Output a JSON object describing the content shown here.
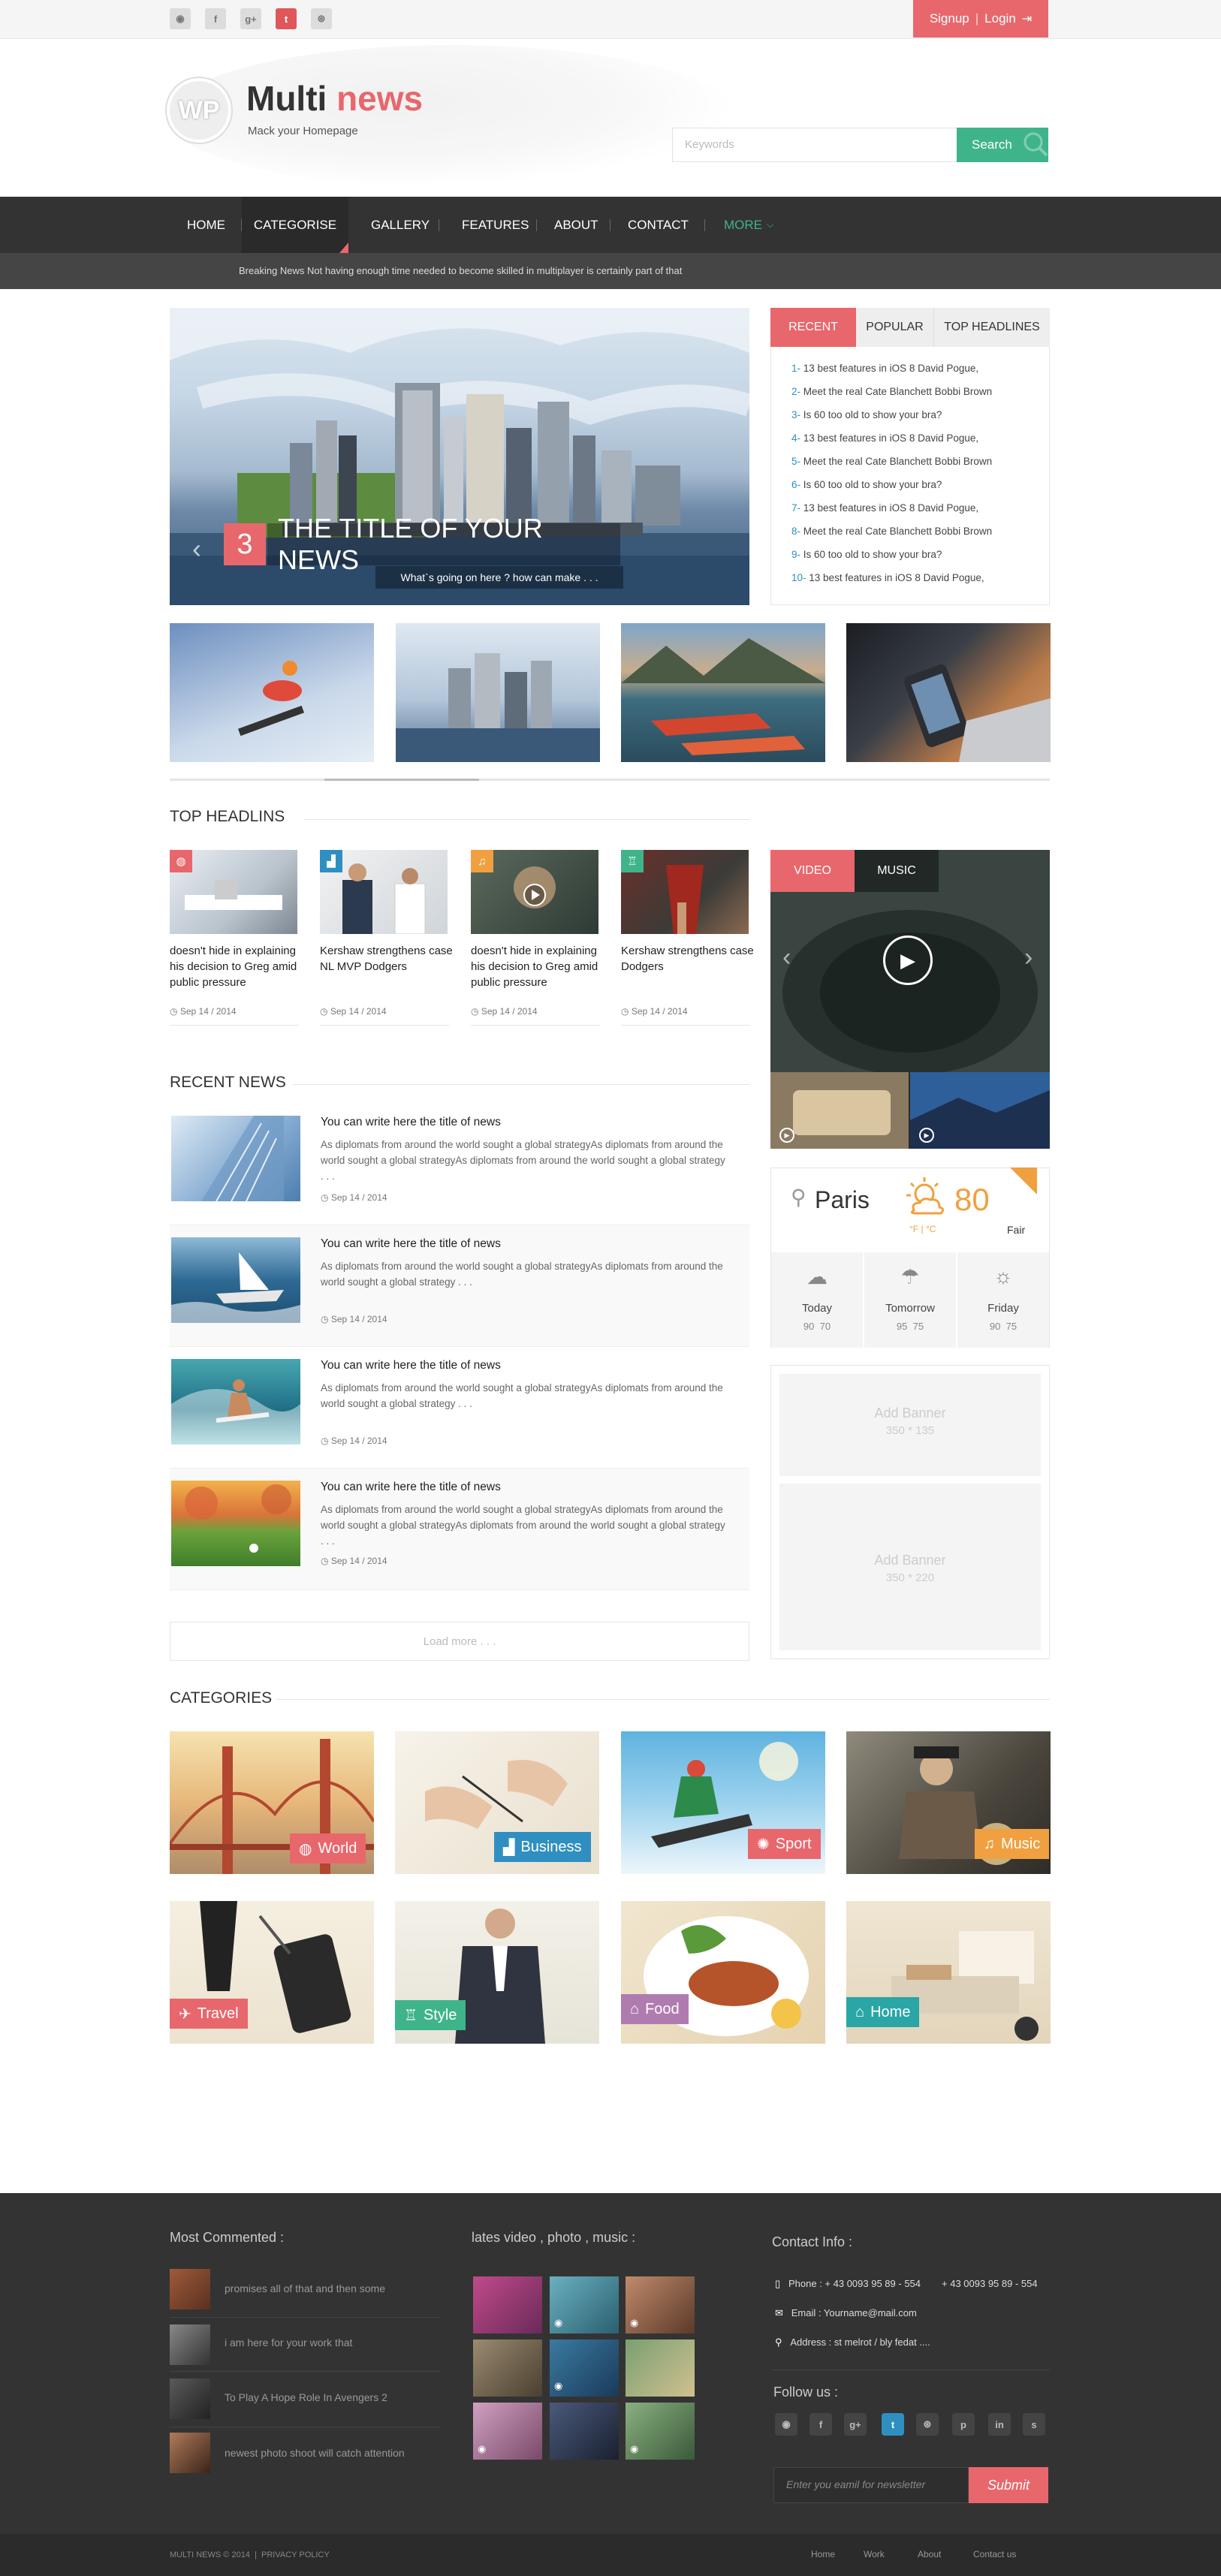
{
  "topbar": {
    "social_icons": [
      "rss-icon",
      "facebook-icon",
      "google-plus-icon",
      "twitter-icon",
      "dribbble-icon"
    ],
    "signup": "Signup",
    "login": "Login"
  },
  "brand": {
    "logo_mark": "WP",
    "title_a": "Multi",
    "title_b": "news",
    "tagline": "Mack your Homepage",
    "accent": "#e8676c",
    "green": "#3fb48b"
  },
  "search": {
    "placeholder": "Keywords",
    "button": "Search"
  },
  "nav": {
    "items": [
      "HOME",
      "CATEGORISE",
      "GALLERY",
      "FEATURES",
      "ABOUT",
      "CONTACT",
      "MORE"
    ]
  },
  "breaking": "Breaking News Not having enough time needed to become skilled in multiplayer is certainly part of that",
  "slider": {
    "number": "3",
    "title": "THE TITLE OF YOUR NEWS",
    "subtitle": "What`s going on here ? how can make . . ."
  },
  "headline_tabs": {
    "tabs": [
      "RECENT",
      "POPULAR",
      "TOP HEADLINES"
    ],
    "items": [
      {
        "n": "1-",
        "t": "13 best features in iOS 8 David Pogue,"
      },
      {
        "n": "2-",
        "t": "Meet the real Cate Blanchett Bobbi Brown"
      },
      {
        "n": "3-",
        "t": "Is 60 too old to show your bra?"
      },
      {
        "n": "4-",
        "t": "13 best features in iOS 8 David Pogue,"
      },
      {
        "n": "5-",
        "t": "Meet the real Cate Blanchett Bobbi Brown"
      },
      {
        "n": "6-",
        "t": "Is 60 too old to show your bra?"
      },
      {
        "n": "7-",
        "t": "13 best features in iOS 8 David Pogue,"
      },
      {
        "n": "8-",
        "t": "Meet the real Cate Blanchett Bobbi Brown"
      },
      {
        "n": "9-",
        "t": "Is 60 too old to show your bra?"
      },
      {
        "n": "10-",
        "t": "13 best features in iOS 8 David Pogue,"
      }
    ]
  },
  "top_headlines": {
    "title": "TOP HEADLINS",
    "cards": [
      {
        "text": "doesn't hide in explaining his decision to Greg amid public pressure",
        "date": "Sep 14 / 2014",
        "icon": "globe-icon",
        "color": "#e8676c"
      },
      {
        "text": "Kershaw strengthens case NL MVP Dodgers",
        "date": "Sep 14 / 2014",
        "icon": "chart-icon",
        "color": "#2f8fc1"
      },
      {
        "text": "doesn't hide in explaining his decision to Greg amid public pressure",
        "date": "Sep 14 / 2014",
        "icon": "music-icon",
        "color": "#f0a040"
      },
      {
        "text": "Kershaw strengthens case Dodgers",
        "date": "Sep 14 / 2014",
        "icon": "shirt-icon",
        "color": "#3fb48b"
      }
    ]
  },
  "recent_news": {
    "title": "RECENT NEWS",
    "items": [
      {
        "title": "You can write here the title of news",
        "desc": "As diplomats from around the world sought a global strategyAs diplomats from around the world sought a global strategyAs diplomats from around the world sought a global strategy . . .",
        "date": "Sep 14 / 2014"
      },
      {
        "title": "You can write here the title of news",
        "desc": "As diplomats from around the world sought a global strategyAs diplomats from around the world sought a global strategy . . .",
        "date": "Sep 14 / 2014"
      },
      {
        "title": "You can write here the title of news",
        "desc": "As diplomats from around the world sought a global strategyAs diplomats from around the world sought a global strategy . . .",
        "date": "Sep 14 / 2014"
      },
      {
        "title": "You can write here the title of news",
        "desc": "As diplomats from around the world sought a global strategyAs diplomats from around the world sought a global strategyAs diplomats from around the world sought a global strategy . . .",
        "date": "Sep 14 / 2014"
      }
    ],
    "load_more": "Load more . . ."
  },
  "media": {
    "tabs": [
      "VIDEO",
      "MUSIC"
    ]
  },
  "weather": {
    "city": "Paris",
    "temp": "80",
    "units": "°F  |  °C",
    "condition": "Fair",
    "forecast": [
      {
        "day": "Today",
        "range": "90  70"
      },
      {
        "day": "Tomorrow",
        "range": "95  75"
      },
      {
        "day": "Friday",
        "range": "90  75"
      }
    ]
  },
  "banners": [
    {
      "label": "Add Banner",
      "size": "350 * 135"
    },
    {
      "label": "Add Banner",
      "size": "350 * 220"
    }
  ],
  "categories": {
    "title": "CATEGORIES",
    "items": [
      {
        "label": "World",
        "color": "#e8676c",
        "icon": "globe-icon"
      },
      {
        "label": "Business",
        "color": "#2f8fc1",
        "icon": "chart-icon"
      },
      {
        "label": "Sport",
        "color": "#e8676c",
        "icon": "ball-icon"
      },
      {
        "label": "Music",
        "color": "#f0a040",
        "icon": "music-icon"
      },
      {
        "label": "Travel",
        "color": "#e8676c",
        "icon": "plane-icon"
      },
      {
        "label": "Style",
        "color": "#3fb48b",
        "icon": "shirt-icon"
      },
      {
        "label": "Food",
        "color": "#b07cb0",
        "icon": "cake-icon"
      },
      {
        "label": "Home",
        "color": "#2aa6a6",
        "icon": "house-icon"
      }
    ]
  },
  "footer": {
    "most_commented_title": "Most Commented :",
    "most_commented": [
      "promises all of that and then some",
      "i am here for your work that",
      "To Play A Hope Role In Avengers 2",
      "newest photo shoot will catch attention"
    ],
    "media_title": "lates video , photo , music :",
    "contact_title": "Contact Info :",
    "phone": "Phone : + 43 0093 95 89 - 554",
    "phone2": "+ 43 0093 95 89 - 554",
    "email": "Email : Yourname@mail.com",
    "address": "Address : st melrot / bly fedat ....",
    "follow_title": "Follow us :",
    "follow_icons": [
      "rss-icon",
      "facebook-icon",
      "google-plus-icon",
      "twitter-icon",
      "dribbble-icon",
      "pinterest-icon",
      "linkedin-icon",
      "skype-icon"
    ],
    "newsletter_placeholder": "Enter you eamil  for newsletter",
    "submit": "Submit",
    "copyright": "MULTI NEWS  © 2014",
    "privacy": "PRIVACY POLICY",
    "links": [
      "Home",
      "Work",
      "About",
      "Contact us"
    ]
  }
}
